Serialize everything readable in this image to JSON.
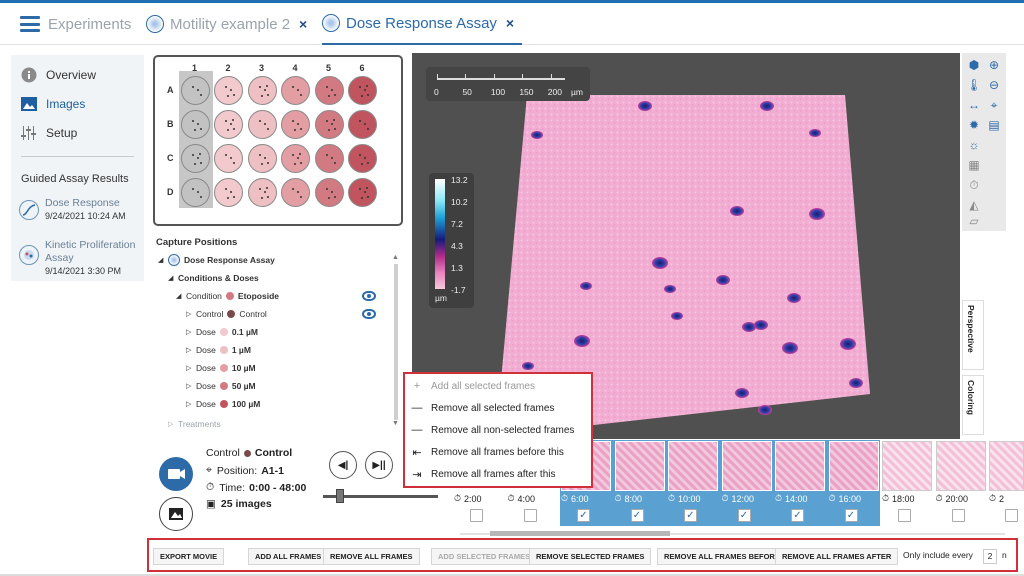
{
  "tabs": [
    {
      "label": "Experiments",
      "close": ""
    },
    {
      "label": "Motility example 2",
      "close": "×"
    },
    {
      "label": "Dose Response Assay",
      "close": "×"
    }
  ],
  "nav": {
    "items": [
      {
        "label": "Overview",
        "icon": "info-icon"
      },
      {
        "label": "Images",
        "icon": "image-icon"
      },
      {
        "label": "Setup",
        "icon": "sliders-icon"
      }
    ],
    "guided_title": "Guided Assay Results",
    "guided": [
      {
        "title": "Dose Response",
        "date": "9/24/2021 10:24 AM"
      },
      {
        "title": "Kinetic Proliferation Assay",
        "date": "9/14/2021 3:30 PM"
      }
    ]
  },
  "plate": {
    "columns": [
      "1",
      "2",
      "3",
      "4",
      "5",
      "6"
    ],
    "rows": [
      "A",
      "B",
      "C",
      "D"
    ],
    "well_colors": [
      "#c2c2c2",
      "#f2c9cc",
      "#eec0c3",
      "#e39ea4",
      "#d27a82",
      "#c05560"
    ]
  },
  "capture": {
    "title": "Capture Positions",
    "assay": "Dose Response Assay",
    "conditions": "Conditions & Doses",
    "condition_label": "Condition",
    "condition_value": "Etoposide",
    "control_label": "Control",
    "control_value": "Control",
    "dose_label": "Dose",
    "doses": [
      {
        "value": "0.1 µM",
        "color": "#f2c9cc"
      },
      {
        "value": "1 µM",
        "color": "#eec0c3"
      },
      {
        "value": "10 µM",
        "color": "#e39ea4"
      },
      {
        "value": "50 µM",
        "color": "#d27a82"
      },
      {
        "value": "100 µM",
        "color": "#c05560"
      }
    ],
    "treatments": "Treatments"
  },
  "info": {
    "control_label": "Control",
    "control_value": "Control",
    "position_label": "Position:",
    "position_value": "A1-1",
    "time_label": "Time:",
    "time_value": "0:00 - 48:00",
    "images_value": "25 images"
  },
  "colorbar": {
    "ticks": [
      "13.2",
      "10.2",
      "7.2",
      "4.3",
      "1.3",
      "-1.7"
    ],
    "unit": "µm"
  },
  "scale": {
    "ticks": [
      "0",
      "50",
      "100",
      "150",
      "200"
    ],
    "unit": "µm"
  },
  "vtabs": [
    "Perspective",
    "Coloring"
  ],
  "context_menu": [
    {
      "label": "Add all selected frames",
      "disabled": true
    },
    {
      "label": "Remove all selected frames",
      "disabled": false
    },
    {
      "label": "Remove all non-selected frames",
      "disabled": false
    },
    {
      "label": "Remove all frames before this",
      "disabled": false
    },
    {
      "label": "Remove all frames after this",
      "disabled": false
    }
  ],
  "frames": [
    {
      "time": "2:00",
      "selected": false
    },
    {
      "time": "4:00",
      "selected": false
    },
    {
      "time": "6:00",
      "selected": true
    },
    {
      "time": "8:00",
      "selected": true
    },
    {
      "time": "10:00",
      "selected": true
    },
    {
      "time": "12:00",
      "selected": true
    },
    {
      "time": "14:00",
      "selected": true
    },
    {
      "time": "16:00",
      "selected": true
    },
    {
      "time": "18:00",
      "selected": false
    },
    {
      "time": "20:00",
      "selected": false
    },
    {
      "time": "2",
      "selected": false
    }
  ],
  "bottom": {
    "export": "EXPORT MOVIE",
    "add_all": "ADD ALL FRAMES",
    "remove_all": "REMOVE ALL FRAMES",
    "add_selected": "ADD SELECTED FRAMES",
    "remove_selected": "REMOVE SELECTED FRAMES",
    "remove_before": "REMOVE ALL FRAMES BEFORE",
    "remove_after": "REMOVE ALL FRAMES AFTER",
    "include_label": "Only include every",
    "include_value": "2",
    "include_suffix": "n"
  },
  "colors": {
    "accent": "#2c6aa8",
    "highlight": "#d0303a",
    "selection": "#5aa0d0"
  }
}
